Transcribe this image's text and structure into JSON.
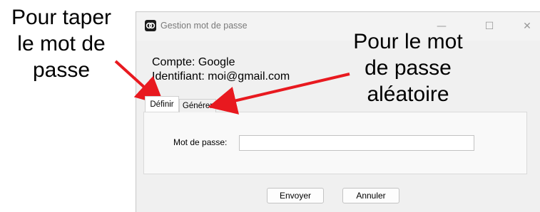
{
  "annotations": {
    "left": "Pour taper\nle mot de\npasse",
    "right": "Pour le mot\nde passe\naléatoire",
    "arrow_color": "#e8191f"
  },
  "window": {
    "title": "Gestion mot de passe",
    "controls": {
      "minimize": "—",
      "maximize": "☐",
      "close": "✕"
    }
  },
  "account": {
    "compte": "Compte: Google",
    "identifiant": "Identifiant: moi@gmail.com"
  },
  "tabs": [
    {
      "label": "Définir",
      "active": true
    },
    {
      "label": "Générer",
      "active": false
    }
  ],
  "form": {
    "password_label": "Mot de passe:",
    "password_value": ""
  },
  "buttons": {
    "send": "Envoyer",
    "cancel": "Annuler"
  }
}
